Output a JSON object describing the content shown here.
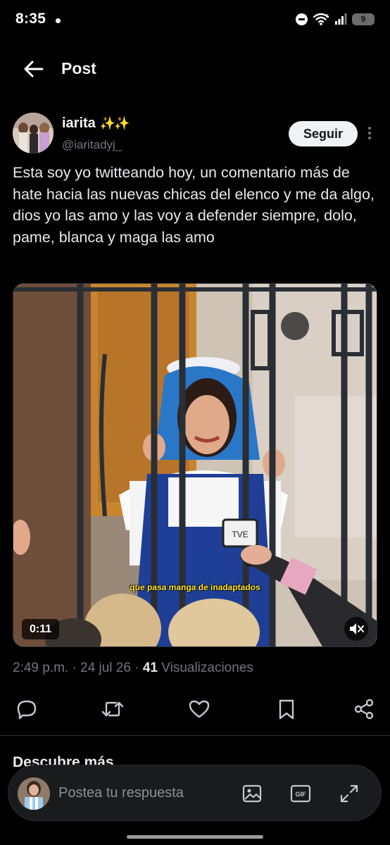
{
  "status_bar": {
    "time": "8:35",
    "battery": "9",
    "icons": [
      "do-not-disturb-icon",
      "wifi-icon",
      "signal-icon",
      "battery-icon"
    ]
  },
  "header": {
    "title": "Post",
    "back_icon": "arrow-left-icon"
  },
  "post": {
    "author": {
      "display_name": "iarita",
      "emoji": "✨✨",
      "handle": "@iaritadyj_"
    },
    "follow_label": "Seguir",
    "text": "Esta soy yo twitteando hoy, un comentario más de hate hacia las nuevas chicas del elenco y me da algo, dios yo las amo y las voy a defender siempre, dolo, pame, blanca y maga las amo",
    "media": {
      "type": "video",
      "subtitle": "que pasa manga de inadaptados",
      "duration": "0:11",
      "mic_logo": "TVE"
    },
    "meta": {
      "time": "2:49 p.m.",
      "date": "24 jul 26",
      "views_count": "41",
      "views_label": "Visualizaciones"
    },
    "actions": [
      "reply-icon",
      "repost-icon",
      "like-icon",
      "bookmark-icon",
      "share-icon"
    ]
  },
  "discover": {
    "title": "Descubre más"
  },
  "reply": {
    "placeholder": "Postea tu respuesta",
    "icons": [
      "image-icon",
      "gif-icon",
      "expand-icon"
    ],
    "gif_label": "GIF"
  },
  "colors": {
    "background": "#000000",
    "text_primary": "#e7e9ea",
    "text_secondary": "#71767b",
    "follow_button": "#eff3f4",
    "divider": "#2f3336",
    "subtitle": "#ffe62e"
  }
}
